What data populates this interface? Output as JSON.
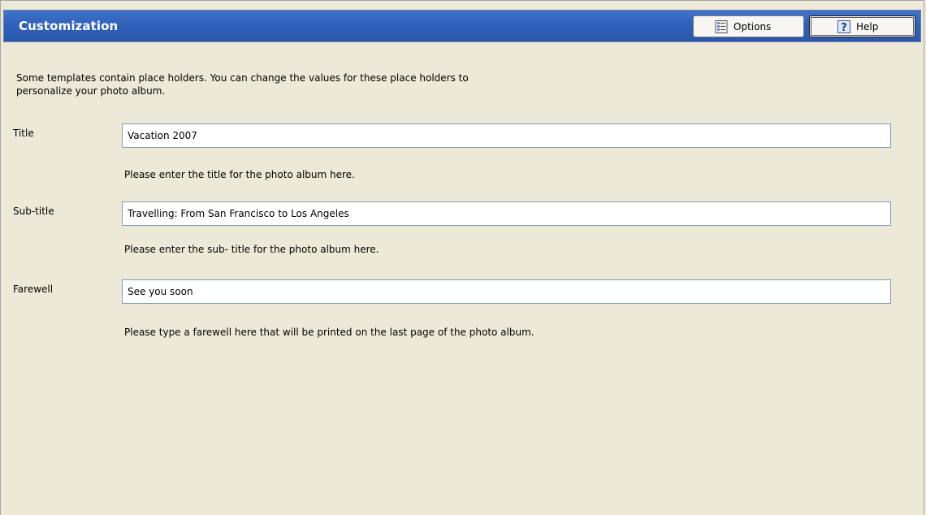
{
  "header": {
    "title": "Customization",
    "options_label": "Options",
    "help_label": "Help",
    "options_icon": "options-list-icon",
    "help_icon": "help-question-icon",
    "bar_color": "#2f5fb7"
  },
  "intro_text": "Some templates contain place holders. You can change the values for these place holders to personalize your photo album.",
  "fields": {
    "title": {
      "label": "Title",
      "value": "Vacation 2007",
      "hint": "Please enter the title for the photo album here."
    },
    "subtitle": {
      "label": "Sub-title",
      "value": "Travelling: From San Francisco to Los Angeles",
      "hint": "Please enter the sub- title for the photo album here."
    },
    "farewell": {
      "label": "Farewell",
      "value": "See you soon",
      "hint": "Please type a farewell here that will be printed on the last page of the photo album."
    }
  }
}
